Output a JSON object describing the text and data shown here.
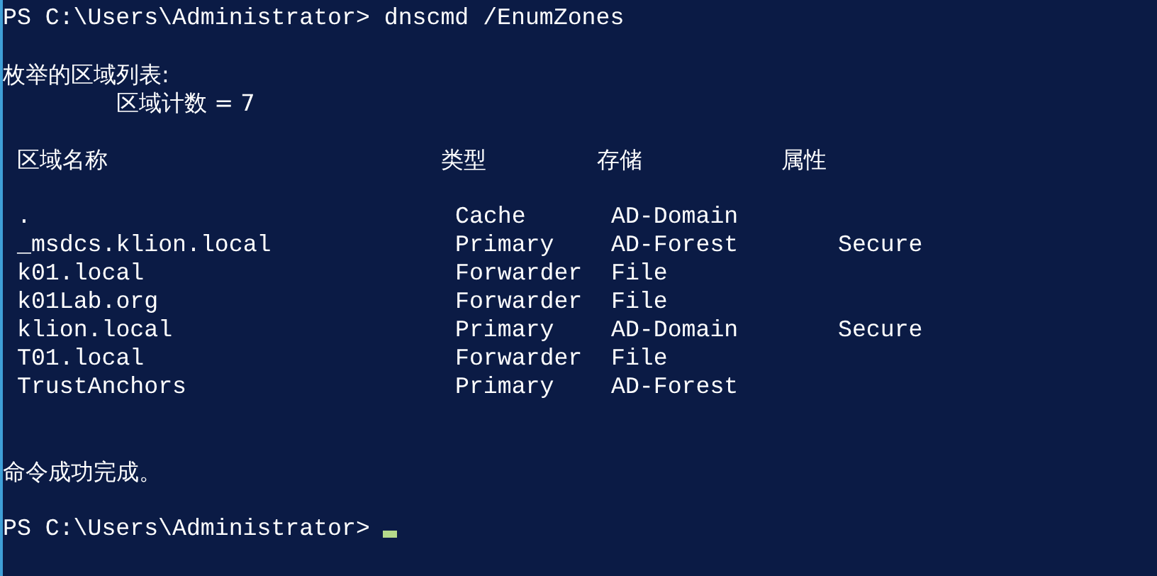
{
  "console": {
    "command_line": "PS C:\\Users\\Administrator> dnscmd /EnumZones",
    "list_title": "枚举的区域列表:",
    "zone_count": "区域计数 = 7",
    "headers": [
      "区域名称",
      "类型",
      "存储",
      "属性"
    ],
    "zones": [
      {
        "name": ".",
        "type": "Cache",
        "storage": "AD-Domain"
      },
      {
        "name": "_msdcs.klion.local",
        "type": "Primary",
        "storage": "AD-Forest",
        "property": "Secure"
      },
      {
        "name": "k01.local",
        "type": "Forwarder",
        "storage": "File"
      },
      {
        "name": "k01Lab.org",
        "type": "Forwarder",
        "storage": "File"
      },
      {
        "name": "klion.local",
        "type": "Primary",
        "storage": "AD-Domain",
        "property": "Secure"
      },
      {
        "name": "T01.local",
        "type": "Forwarder",
        "storage": "File"
      },
      {
        "name": "TrustAnchors",
        "type": "Primary",
        "storage": "AD-Forest"
      }
    ],
    "result": "命令成功完成。",
    "prompt": "PS C:\\Users\\Administrator>"
  }
}
